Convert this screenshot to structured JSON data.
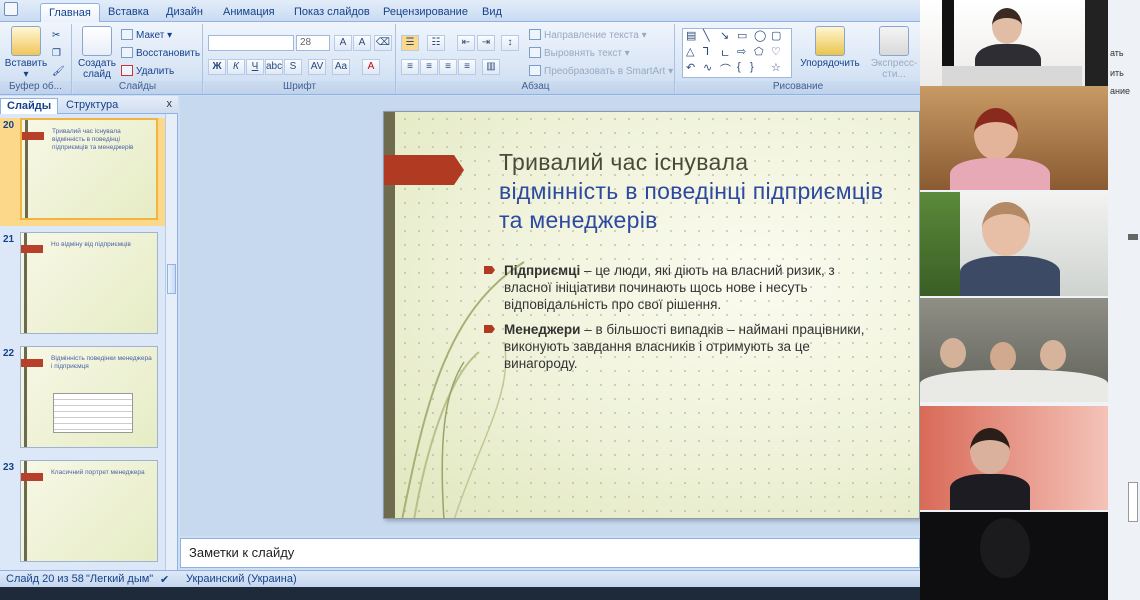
{
  "ribbon": {
    "tabs": [
      "Главная",
      "Вставка",
      "Дизайн",
      "Анимация",
      "Показ слайдов",
      "Рецензирование",
      "Вид"
    ],
    "active_tab": "Главная",
    "clipboard": {
      "paste": "Вставить",
      "label": "Буфер об..."
    },
    "slides": {
      "create": "Создать слайд",
      "layout": "Макет",
      "reset": "Восстановить",
      "delete": "Удалить",
      "label": "Слайды"
    },
    "font": {
      "size": "28",
      "label": "Шрифт"
    },
    "paragraph": {
      "direction": "Направление текста",
      "align": "Выровнять текст",
      "smartart": "Преобразовать в SmartArt",
      "label": "Абзац"
    },
    "drawing": {
      "arrange": "Упорядочить",
      "styles": "Экспресс-сти...",
      "label": "Рисование"
    }
  },
  "panel": {
    "tabs": [
      "Слайды",
      "Структура"
    ],
    "close": "x",
    "thumbnails": [
      {
        "num": "20",
        "title": "Тривалий час існувала відмінність в поведінці підприємців та менеджерів",
        "selected": true
      },
      {
        "num": "21",
        "title": "Но відміну від підприємців",
        "selected": false
      },
      {
        "num": "22",
        "title": "Відмінність поведінки менеджера і підприємця",
        "selected": false
      },
      {
        "num": "23",
        "title": "Класичний портрет менеджера",
        "selected": false
      }
    ]
  },
  "slide": {
    "title_first": "Тривалий час існувала",
    "title_rest": "відмінність в поведінці підприємців та менеджерів",
    "bullets": [
      {
        "term": "Підприємці",
        "text": " – це люди, які діють на власний ризик, з власної ініціативи починають щось нове і несуть відповідальність про свої рішення."
      },
      {
        "term": "Менеджери",
        "text": " – в більшості випадків – наймані працівники, виконують завдання власників і отримують за це винагороду."
      }
    ]
  },
  "notes": {
    "placeholder": "Заметки к слайду"
  },
  "status": {
    "slide": "Слайд 20 из 58",
    "theme": "\"Легкий дым\"",
    "lang": "Украинский (Украина)"
  },
  "colors": {
    "accent": "#b13b22",
    "title": "#2c4aa0",
    "ribbon": "#dbe7f6"
  }
}
